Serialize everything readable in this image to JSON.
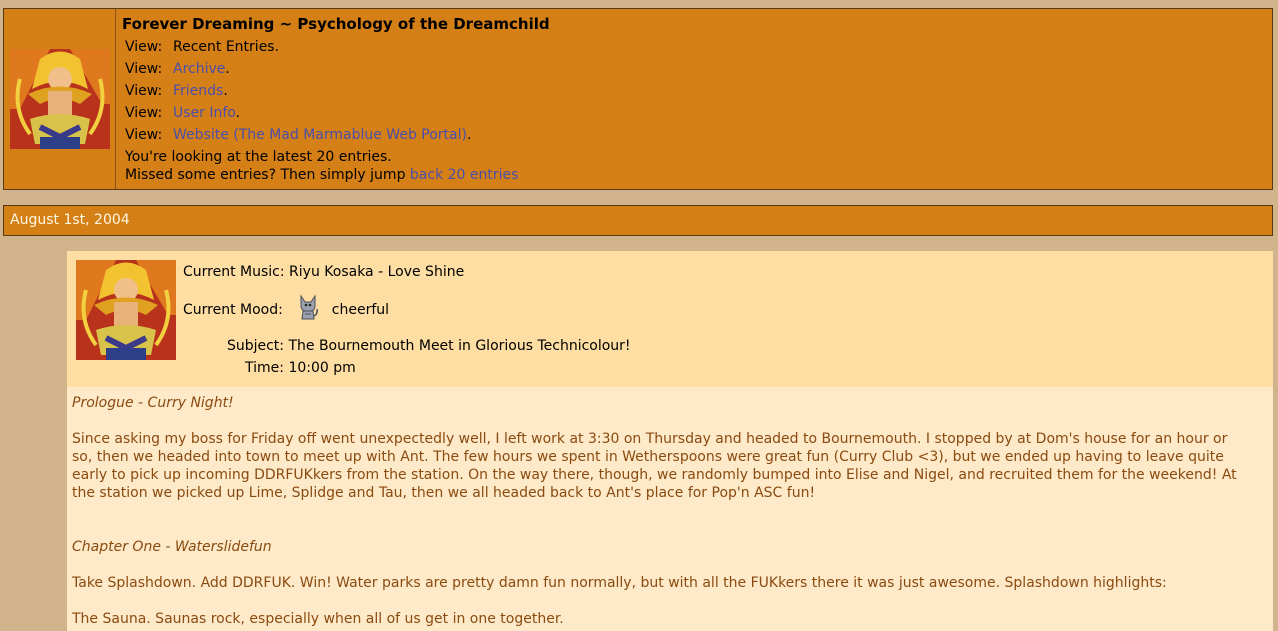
{
  "header": {
    "title": "Forever Dreaming ~ Psychology of the Dreamchild",
    "view_label": "View:",
    "views": [
      {
        "text": "Recent Entries",
        "link": false
      },
      {
        "text": "Archive",
        "link": true
      },
      {
        "text": "Friends",
        "link": true
      },
      {
        "text": "User Info",
        "link": true
      },
      {
        "text": "Website (The Mad Marmablue Web Portal)",
        "link": true
      }
    ],
    "latest_note": "You're looking at the latest 20 entries.",
    "missed_note": "Missed some entries? Then simply jump ",
    "back_link": "back 20 entries"
  },
  "date_heading": "August 1st, 2004",
  "entry": {
    "music_label": "Current Music:",
    "music": "Riyu Kosaka - Love Shine",
    "mood_label": "Current Mood:",
    "mood_icon": "cat-icon",
    "mood": "cheerful",
    "subject_label": "Subject:",
    "subject": "The Bournemouth Meet in Glorious Technicolour!",
    "time_label": "Time:",
    "time": "10:00 pm",
    "prologue_heading": "Prologue - Curry Night!",
    "prologue_text": "Since asking my boss for Friday off went unexpectedly well, I left work at 3:30 on Thursday and headed to Bournemouth. I stopped by at Dom's house for an hour or so, then we headed into town to meet up with Ant. The few hours we spent in Wetherspoons were great fun (Curry Club <3), but we ended up having to leave quite early to pick up incoming DDRFUKkers from the station. On the way there, though, we randomly bumped into Elise and Nigel, and recruited them for the weekend! At the station we picked up Lime, Splidge and Tau, then we all headed back to Ant's place for Pop'n ASC fun!",
    "chapter1_heading": "Chapter One - Waterslidefun",
    "chapter1_text": "Take Splashdown. Add DDRFUK. Win! Water parks are pretty damn fun normally, but with all the FUKkers there it was just awesome. Splashdown highlights:",
    "sauna_text": "The Sauna. Saunas rock, especially when all of us get in one together."
  }
}
